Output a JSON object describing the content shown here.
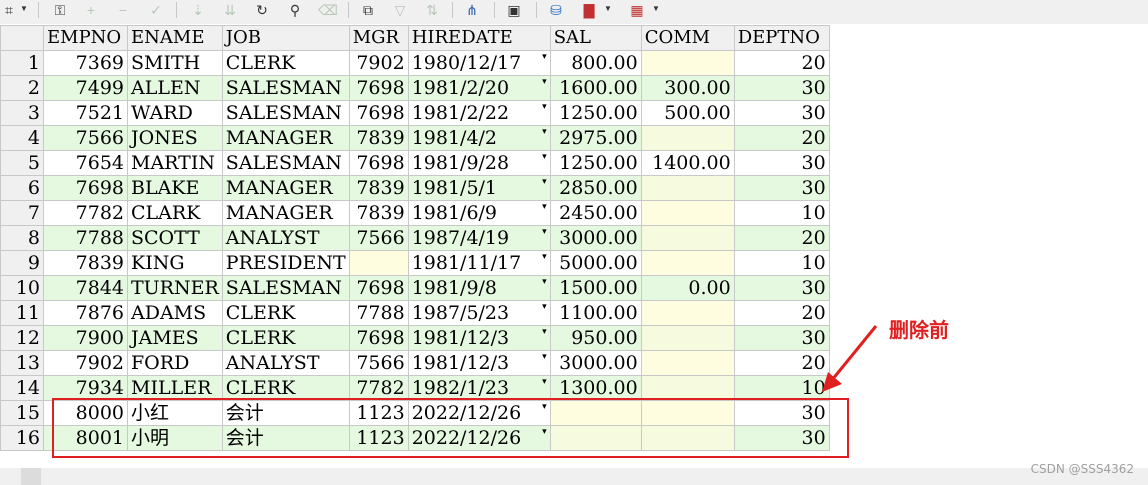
{
  "toolbar": {
    "items": [
      {
        "name": "grid-select-icon",
        "glyph": "⌗"
      },
      {
        "name": "lock-icon",
        "glyph": "🔒"
      },
      {
        "name": "add-record-icon",
        "glyph": "+"
      },
      {
        "name": "delete-record-icon",
        "glyph": "−"
      },
      {
        "name": "post-icon",
        "glyph": "✓"
      },
      {
        "name": "move-down-icon",
        "glyph": "⇣"
      },
      {
        "name": "move-down-all-icon",
        "glyph": "⇊"
      },
      {
        "name": "refresh-icon",
        "glyph": "↻"
      },
      {
        "name": "find-icon",
        "glyph": "🔭"
      },
      {
        "name": "clear-icon",
        "glyph": "⌫"
      },
      {
        "name": "copy-icon",
        "glyph": "⧉"
      },
      {
        "name": "filter-icon",
        "glyph": "▽"
      },
      {
        "name": "sort-icon",
        "glyph": "⇅"
      },
      {
        "name": "tree-icon",
        "glyph": "⋔"
      },
      {
        "name": "save-icon",
        "glyph": "💾"
      },
      {
        "name": "database-icon",
        "glyph": "⛁"
      },
      {
        "name": "chart-icon",
        "glyph": "▇"
      },
      {
        "name": "export-icon",
        "glyph": "▦"
      }
    ]
  },
  "grid": {
    "columns": [
      "EMPNO",
      "ENAME",
      "JOB",
      "MGR",
      "HIREDATE",
      "SAL",
      "COMM",
      "DEPTNO"
    ],
    "rows": [
      {
        "n": "1",
        "empno": "7369",
        "ename": "SMITH",
        "job": "CLERK",
        "mgr": "7902",
        "hiredate": "1980/12/17",
        "sal": "800.00",
        "comm": "",
        "deptno": "20"
      },
      {
        "n": "2",
        "empno": "7499",
        "ename": "ALLEN",
        "job": "SALESMAN",
        "mgr": "7698",
        "hiredate": "1981/2/20",
        "sal": "1600.00",
        "comm": "300.00",
        "deptno": "30"
      },
      {
        "n": "3",
        "empno": "7521",
        "ename": "WARD",
        "job": "SALESMAN",
        "mgr": "7698",
        "hiredate": "1981/2/22",
        "sal": "1250.00",
        "comm": "500.00",
        "deptno": "30"
      },
      {
        "n": "4",
        "empno": "7566",
        "ename": "JONES",
        "job": "MANAGER",
        "mgr": "7839",
        "hiredate": "1981/4/2",
        "sal": "2975.00",
        "comm": "",
        "deptno": "20"
      },
      {
        "n": "5",
        "empno": "7654",
        "ename": "MARTIN",
        "job": "SALESMAN",
        "mgr": "7698",
        "hiredate": "1981/9/28",
        "sal": "1250.00",
        "comm": "1400.00",
        "deptno": "30"
      },
      {
        "n": "6",
        "empno": "7698",
        "ename": "BLAKE",
        "job": "MANAGER",
        "mgr": "7839",
        "hiredate": "1981/5/1",
        "sal": "2850.00",
        "comm": "",
        "deptno": "30"
      },
      {
        "n": "7",
        "empno": "7782",
        "ename": "CLARK",
        "job": "MANAGER",
        "mgr": "7839",
        "hiredate": "1981/6/9",
        "sal": "2450.00",
        "comm": "",
        "deptno": "10"
      },
      {
        "n": "8",
        "empno": "7788",
        "ename": "SCOTT",
        "job": "ANALYST",
        "mgr": "7566",
        "hiredate": "1987/4/19",
        "sal": "3000.00",
        "comm": "",
        "deptno": "20"
      },
      {
        "n": "9",
        "empno": "7839",
        "ename": "KING",
        "job": "PRESIDENT",
        "mgr": "",
        "hiredate": "1981/11/17",
        "sal": "5000.00",
        "comm": "",
        "deptno": "10"
      },
      {
        "n": "10",
        "empno": "7844",
        "ename": "TURNER",
        "job": "SALESMAN",
        "mgr": "7698",
        "hiredate": "1981/9/8",
        "sal": "1500.00",
        "comm": "0.00",
        "deptno": "30"
      },
      {
        "n": "11",
        "empno": "7876",
        "ename": "ADAMS",
        "job": "CLERK",
        "mgr": "7788",
        "hiredate": "1987/5/23",
        "sal": "1100.00",
        "comm": "",
        "deptno": "20"
      },
      {
        "n": "12",
        "empno": "7900",
        "ename": "JAMES",
        "job": "CLERK",
        "mgr": "7698",
        "hiredate": "1981/12/3",
        "sal": "950.00",
        "comm": "",
        "deptno": "30"
      },
      {
        "n": "13",
        "empno": "7902",
        "ename": "FORD",
        "job": "ANALYST",
        "mgr": "7566",
        "hiredate": "1981/12/3",
        "sal": "3000.00",
        "comm": "",
        "deptno": "20"
      },
      {
        "n": "14",
        "empno": "7934",
        "ename": "MILLER",
        "job": "CLERK",
        "mgr": "7782",
        "hiredate": "1982/1/23",
        "sal": "1300.00",
        "comm": "",
        "deptno": "10"
      },
      {
        "n": "15",
        "empno": "8000",
        "ename": "小红",
        "job": "会计",
        "mgr": "1123",
        "hiredate": "2022/12/26",
        "sal": "",
        "comm": "",
        "deptno": "30"
      },
      {
        "n": "16",
        "empno": "8001",
        "ename": "小明",
        "job": "会计",
        "mgr": "1123",
        "hiredate": "2022/12/26",
        "sal": "",
        "comm": "",
        "deptno": "30"
      }
    ]
  },
  "annotation": {
    "label": "删除前",
    "color": "#e02020"
  },
  "watermark": "CSDN @SSS4362"
}
